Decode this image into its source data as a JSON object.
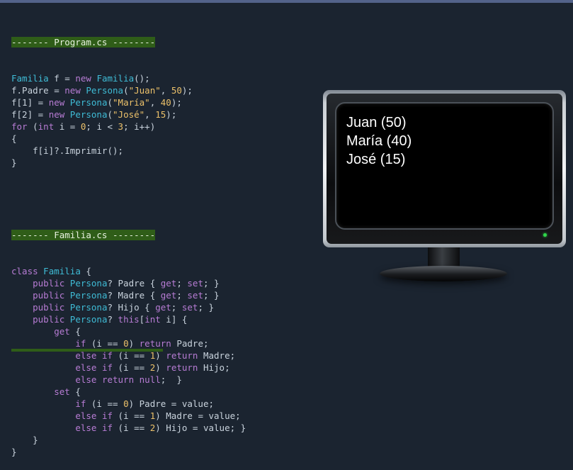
{
  "program": {
    "header": "------- Program.cs --------",
    "lines": [
      [
        {
          "t": "Familia",
          "c": "ty"
        },
        {
          "t": " f = ",
          "c": "pl"
        },
        {
          "t": "new",
          "c": "kw"
        },
        {
          "t": " ",
          "c": "pl"
        },
        {
          "t": "Familia",
          "c": "ty"
        },
        {
          "t": "();",
          "c": "pl"
        }
      ],
      [
        {
          "t": "f.Padre = ",
          "c": "pl"
        },
        {
          "t": "new",
          "c": "kw"
        },
        {
          "t": " ",
          "c": "pl"
        },
        {
          "t": "Persona",
          "c": "ty"
        },
        {
          "t": "(",
          "c": "pl"
        },
        {
          "t": "\"Juan\"",
          "c": "st"
        },
        {
          "t": ", ",
          "c": "pl"
        },
        {
          "t": "50",
          "c": "nm"
        },
        {
          "t": ");",
          "c": "pl"
        }
      ],
      [
        {
          "t": "f[1] = ",
          "c": "pl"
        },
        {
          "t": "new",
          "c": "kw"
        },
        {
          "t": " ",
          "c": "pl"
        },
        {
          "t": "Persona",
          "c": "ty"
        },
        {
          "t": "(",
          "c": "pl"
        },
        {
          "t": "\"María\"",
          "c": "st"
        },
        {
          "t": ", ",
          "c": "pl"
        },
        {
          "t": "40",
          "c": "nm"
        },
        {
          "t": ");",
          "c": "pl"
        }
      ],
      [
        {
          "t": "f[2] = ",
          "c": "pl"
        },
        {
          "t": "new",
          "c": "kw"
        },
        {
          "t": " ",
          "c": "pl"
        },
        {
          "t": "Persona",
          "c": "ty"
        },
        {
          "t": "(",
          "c": "pl"
        },
        {
          "t": "\"José\"",
          "c": "st"
        },
        {
          "t": ", ",
          "c": "pl"
        },
        {
          "t": "15",
          "c": "nm"
        },
        {
          "t": ");",
          "c": "pl"
        }
      ],
      [
        {
          "t": "for",
          "c": "kw"
        },
        {
          "t": " (",
          "c": "pl"
        },
        {
          "t": "int",
          "c": "kw"
        },
        {
          "t": " i = ",
          "c": "pl"
        },
        {
          "t": "0",
          "c": "nm"
        },
        {
          "t": "; i < ",
          "c": "pl"
        },
        {
          "t": "3",
          "c": "nm"
        },
        {
          "t": "; i++)",
          "c": "pl"
        }
      ],
      [
        {
          "t": "{",
          "c": "pl"
        }
      ],
      [
        {
          "t": "    f[i]?.Imprimir();",
          "c": "pl"
        }
      ],
      [
        {
          "t": "}",
          "c": "pl"
        }
      ]
    ]
  },
  "familia": {
    "header": "------- Familia.cs --------",
    "lines": [
      [
        {
          "t": "class",
          "c": "kw"
        },
        {
          "t": " ",
          "c": "pl"
        },
        {
          "t": "Familia",
          "c": "ty"
        },
        {
          "t": " {",
          "c": "pl"
        }
      ],
      [
        {
          "t": "    ",
          "c": "pl"
        },
        {
          "t": "public",
          "c": "kw"
        },
        {
          "t": " ",
          "c": "pl"
        },
        {
          "t": "Persona",
          "c": "ty"
        },
        {
          "t": "? Padre { ",
          "c": "pl"
        },
        {
          "t": "get",
          "c": "kw"
        },
        {
          "t": "; ",
          "c": "pl"
        },
        {
          "t": "set",
          "c": "kw"
        },
        {
          "t": "; }",
          "c": "pl"
        }
      ],
      [
        {
          "t": "    ",
          "c": "pl"
        },
        {
          "t": "public",
          "c": "kw"
        },
        {
          "t": " ",
          "c": "pl"
        },
        {
          "t": "Persona",
          "c": "ty"
        },
        {
          "t": "? Madre { ",
          "c": "pl"
        },
        {
          "t": "get",
          "c": "kw"
        },
        {
          "t": "; ",
          "c": "pl"
        },
        {
          "t": "set",
          "c": "kw"
        },
        {
          "t": "; }",
          "c": "pl"
        }
      ],
      [
        {
          "t": "    ",
          "c": "pl"
        },
        {
          "t": "public",
          "c": "kw"
        },
        {
          "t": " ",
          "c": "pl"
        },
        {
          "t": "Persona",
          "c": "ty"
        },
        {
          "t": "? Hijo { ",
          "c": "pl"
        },
        {
          "t": "get",
          "c": "kw"
        },
        {
          "t": "; ",
          "c": "pl"
        },
        {
          "t": "set",
          "c": "kw"
        },
        {
          "t": "; }",
          "c": "pl"
        }
      ],
      [
        {
          "t": "    ",
          "c": "pl"
        },
        {
          "t": "public",
          "c": "kw"
        },
        {
          "t": " ",
          "c": "pl"
        },
        {
          "t": "Persona",
          "c": "ty"
        },
        {
          "t": "? ",
          "c": "pl"
        },
        {
          "t": "this",
          "c": "kw"
        },
        {
          "t": "[",
          "c": "pl"
        },
        {
          "t": "int",
          "c": "kw"
        },
        {
          "t": " i] {",
          "c": "pl"
        }
      ],
      [
        {
          "t": "        ",
          "c": "pl"
        },
        {
          "t": "get",
          "c": "kw"
        },
        {
          "t": " {",
          "c": "pl"
        }
      ],
      [
        {
          "t": "            ",
          "c": "pl"
        },
        {
          "t": "if",
          "c": "kw"
        },
        {
          "t": " (i == ",
          "c": "pl"
        },
        {
          "t": "0",
          "c": "nm"
        },
        {
          "t": ") ",
          "c": "pl"
        },
        {
          "t": "return",
          "c": "kw"
        },
        {
          "t": " Padre;",
          "c": "pl"
        }
      ],
      [
        {
          "t": "            ",
          "c": "pl"
        },
        {
          "t": "else",
          "c": "kw"
        },
        {
          "t": " ",
          "c": "pl"
        },
        {
          "t": "if",
          "c": "kw"
        },
        {
          "t": " (i == ",
          "c": "pl"
        },
        {
          "t": "1",
          "c": "nm"
        },
        {
          "t": ") ",
          "c": "pl"
        },
        {
          "t": "return",
          "c": "kw"
        },
        {
          "t": " Madre;",
          "c": "pl"
        }
      ],
      [
        {
          "t": "            ",
          "c": "pl"
        },
        {
          "t": "else",
          "c": "kw"
        },
        {
          "t": " ",
          "c": "pl"
        },
        {
          "t": "if",
          "c": "kw"
        },
        {
          "t": " (i == ",
          "c": "pl"
        },
        {
          "t": "2",
          "c": "nm"
        },
        {
          "t": ") ",
          "c": "pl"
        },
        {
          "t": "return",
          "c": "kw"
        },
        {
          "t": " Hijo;",
          "c": "pl"
        }
      ],
      [
        {
          "t": "            ",
          "c": "pl"
        },
        {
          "t": "else",
          "c": "kw"
        },
        {
          "t": " ",
          "c": "pl"
        },
        {
          "t": "return",
          "c": "kw"
        },
        {
          "t": " ",
          "c": "pl"
        },
        {
          "t": "null",
          "c": "kw"
        },
        {
          "t": ";  }",
          "c": "pl"
        }
      ],
      [
        {
          "t": "        ",
          "c": "pl"
        },
        {
          "t": "set",
          "c": "kw"
        },
        {
          "t": " {",
          "c": "pl"
        }
      ],
      [
        {
          "t": "            ",
          "c": "pl"
        },
        {
          "t": "if",
          "c": "kw"
        },
        {
          "t": " (i == ",
          "c": "pl"
        },
        {
          "t": "0",
          "c": "nm"
        },
        {
          "t": ") Padre = value;",
          "c": "pl"
        }
      ],
      [
        {
          "t": "            ",
          "c": "pl"
        },
        {
          "t": "else",
          "c": "kw"
        },
        {
          "t": " ",
          "c": "pl"
        },
        {
          "t": "if",
          "c": "kw"
        },
        {
          "t": " (i == ",
          "c": "pl"
        },
        {
          "t": "1",
          "c": "nm"
        },
        {
          "t": ") Madre = value;",
          "c": "pl"
        }
      ],
      [
        {
          "t": "            ",
          "c": "pl"
        },
        {
          "t": "else",
          "c": "kw"
        },
        {
          "t": " ",
          "c": "pl"
        },
        {
          "t": "if",
          "c": "kw"
        },
        {
          "t": " (i == ",
          "c": "pl"
        },
        {
          "t": "2",
          "c": "nm"
        },
        {
          "t": ") Hijo = value; }",
          "c": "pl"
        }
      ],
      [
        {
          "t": "    }",
          "c": "pl"
        }
      ],
      [
        {
          "t": "}",
          "c": "pl"
        }
      ]
    ]
  },
  "monitor": {
    "output_lines": [
      "Juan (50)",
      "María (40)",
      "José (15)"
    ]
  },
  "colors": {
    "background": "#1b2430",
    "header_bg": "#2f5d18",
    "keyword": "#b77cd4",
    "type": "#3fbcd6",
    "string": "#ecc16a",
    "text": "#c9d3dd",
    "led": "#2fd64a"
  }
}
